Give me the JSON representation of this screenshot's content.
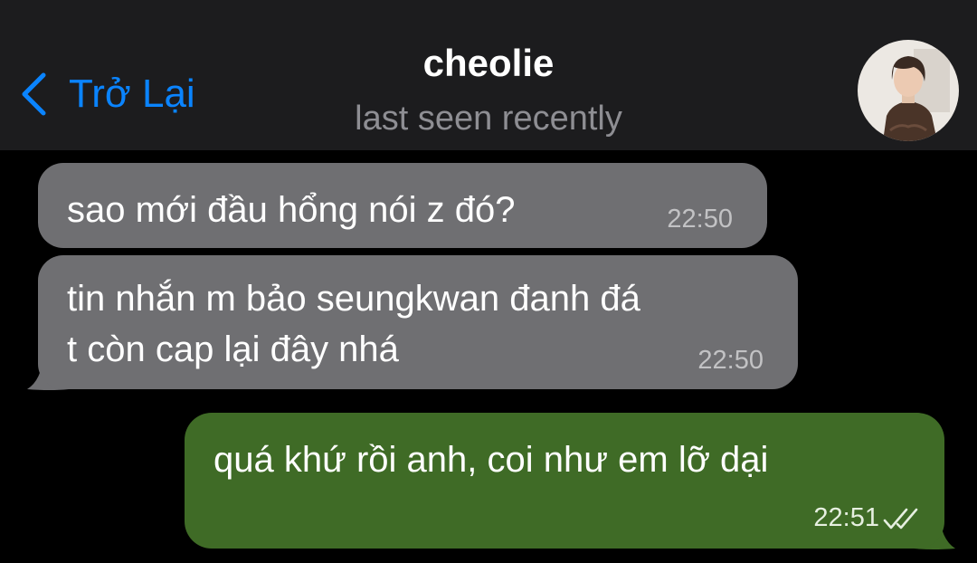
{
  "header": {
    "back_label": "Trở Lại",
    "title": "cheolie",
    "subtitle": "last seen recently"
  },
  "messages": [
    {
      "direction": "incoming",
      "text_lines": [
        "sao mới đầu hổng nói z đó?"
      ],
      "time": "22:50"
    },
    {
      "direction": "incoming",
      "text_lines": [
        "tin nhắn m bảo seungkwan đanh đá",
        "t còn cap lại đây nhá"
      ],
      "time": "22:50"
    },
    {
      "direction": "outgoing",
      "text_lines": [
        "quá khứ rồi anh, coi như em lỡ dại"
      ],
      "time": "22:51",
      "status": "read"
    }
  ],
  "colors": {
    "header_bg": "#1c1c1e",
    "accent": "#0a84ff",
    "incoming_bubble": "#6f6f72",
    "outgoing_bubble": "#3f6b26",
    "background": "#000000"
  },
  "icons": {
    "back": "chevron-left-icon",
    "read_status": "double-check-icon"
  }
}
